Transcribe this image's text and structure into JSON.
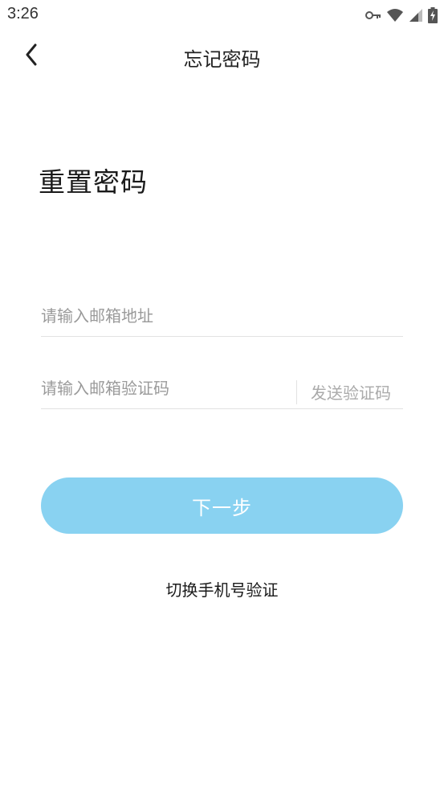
{
  "status_bar": {
    "time": "3:26",
    "icons": [
      "key-icon",
      "wifi-icon",
      "signal-icon",
      "battery-charging-icon"
    ]
  },
  "header": {
    "back_icon": "chevron-left-icon",
    "title": "忘记密码"
  },
  "heading": "重置密码",
  "form": {
    "email": {
      "value": "",
      "placeholder": "请输入邮箱地址"
    },
    "code": {
      "value": "",
      "placeholder": "请输入邮箱验证码"
    },
    "send_code_label": "发送验证码"
  },
  "next_button_label": "下一步",
  "switch_label": "切换手机号验证",
  "colors": {
    "primary_button": "#89d2f1",
    "divider": "#e2e2e2",
    "placeholder": "#9a9a9a"
  }
}
